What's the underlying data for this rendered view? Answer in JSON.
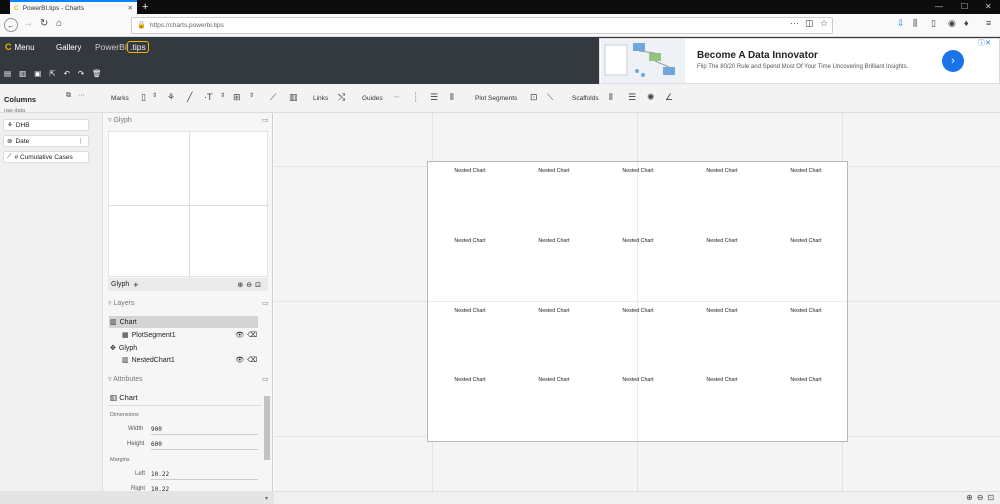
{
  "browser": {
    "tab_title": "PowerBI.tips - Charts",
    "url": "https://charts.powerbi.tips"
  },
  "header": {
    "menu_label": "Menu",
    "gallery_label": "Gallery",
    "brand_main": "PowerBI",
    "brand_tips": ".tips"
  },
  "ad": {
    "title": "Become A Data Innovator",
    "text": "Flip The 80/20 Rule and Spend Most Of Your Time Uncovering Brilliant Insights."
  },
  "ribbon": {
    "marks": "Marks",
    "links": "Links",
    "guides": "Guides",
    "plot_segments": "Plot Segments",
    "scaffolds": "Scaffolds"
  },
  "columns": {
    "title": "Columns",
    "subtitle": "raw data",
    "items": [
      "DHB",
      "Date",
      "# Cumulative Cases"
    ]
  },
  "glyph": {
    "section_title": "Glyph",
    "tab_label": "Glyph"
  },
  "layers": {
    "section_title": "Layers",
    "items": [
      "Chart",
      "PlotSegment1",
      "Glyph",
      "NestedChart1"
    ]
  },
  "attributes": {
    "section_title": "Attributes",
    "object": "Chart",
    "dimensions_label": "Dimensions",
    "width_label": "Width",
    "width_value": "900",
    "height_label": "Height",
    "height_value": "600",
    "margins_label": "Margins",
    "left_label": "Left",
    "left_value": "10.22",
    "right_label": "Right",
    "right_value": "10.22"
  },
  "canvas": {
    "nested_label": "Nested Chart",
    "rows": 4,
    "cols": 5
  }
}
